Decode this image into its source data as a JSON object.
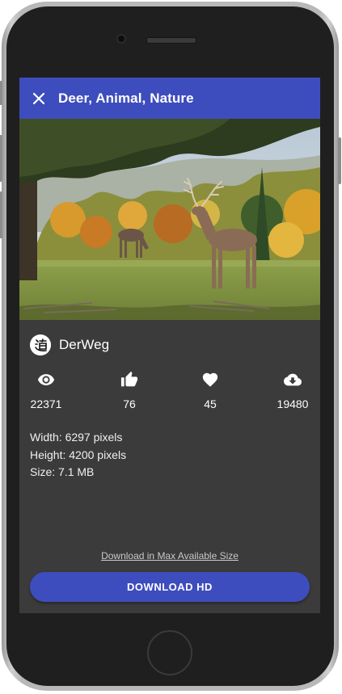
{
  "appbar": {
    "title": "Deer, Animal, Nature"
  },
  "author": {
    "name": "DerWeg",
    "avatar_glyph": "道"
  },
  "stats": [
    {
      "icon": "eye-icon",
      "value": "22371"
    },
    {
      "icon": "thumb-up-icon",
      "value": "76"
    },
    {
      "icon": "heart-icon",
      "value": "45"
    },
    {
      "icon": "cloud-download-icon",
      "value": "19480"
    }
  ],
  "meta": {
    "width": "Width: 6297 pixels",
    "height": "Height: 4200 pixels",
    "size": "Size: 7.1 MB"
  },
  "actions": {
    "max_size_link": "Download in Max Available Size",
    "download_hd": "DOWNLOAD HD"
  },
  "colors": {
    "primary": "#3e4dbd",
    "background": "#3b3b3b",
    "text": "#ffffff"
  }
}
